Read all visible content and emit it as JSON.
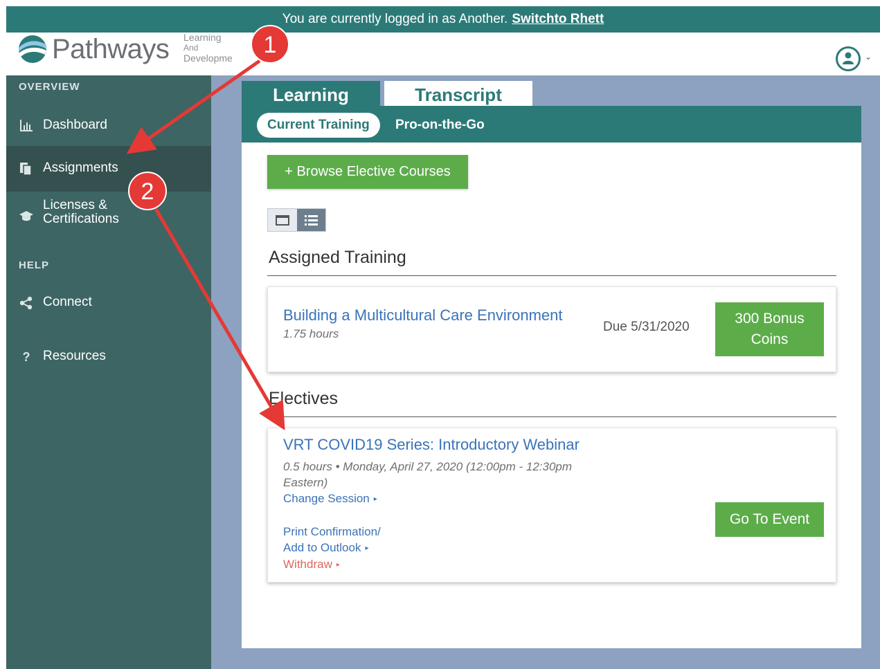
{
  "banner": {
    "text": "You are currently logged in as Another.",
    "switch_link": "Switchto Rhett"
  },
  "logo": {
    "brand": "Pathways",
    "sub_line1": "Learning",
    "sub_line2": "And",
    "sub_line3": "Developme"
  },
  "sidebar": {
    "overview_heading": "OVERVIEW",
    "help_heading": "HELP",
    "items": [
      {
        "label": "Dashboard",
        "icon": "bar-chart-icon"
      },
      {
        "label": "Assignments",
        "icon": "assignments-icon",
        "active": true
      },
      {
        "label_line1": "Licenses &",
        "label_line2": "Certifications",
        "icon": "graduation-cap-icon"
      },
      {
        "label": "Connect",
        "icon": "share-icon"
      },
      {
        "label": "Resources",
        "icon": "question-icon"
      }
    ]
  },
  "tabs": {
    "learning": "Learning",
    "transcript": "Transcript"
  },
  "subtabs": {
    "current": "Current Training",
    "pro": "Pro-on-the-Go"
  },
  "browse_button": "+ Browse Elective Courses",
  "assigned": {
    "title": "Assigned Training",
    "course": "Building a Multicultural Care Environment",
    "hours": "1.75 hours",
    "due": "Due 5/31/2020",
    "coins_line1": "300 Bonus",
    "coins_line2": "Coins"
  },
  "electives": {
    "title": "Electives",
    "course": "VRT COVID19 Series: Introductory Webinar",
    "meta_line1": "0.5 hours • Monday, April 27, 2020 (12:00pm - 12:30pm",
    "meta_line2": "Eastern)",
    "change_session": "Change Session",
    "print_line1": "Print Confirmation/",
    "print_line2": "Add to Outlook",
    "withdraw": "Withdraw",
    "go_button": "Go To Event"
  },
  "annotations": {
    "step1": "1",
    "step2": "2"
  },
  "colors": {
    "teal": "#2c7a78",
    "sidebar": "#3d6563",
    "green": "#5cad4a",
    "link": "#3a73b8",
    "withdraw": "#e0675a",
    "annotation_red": "#e53935"
  }
}
